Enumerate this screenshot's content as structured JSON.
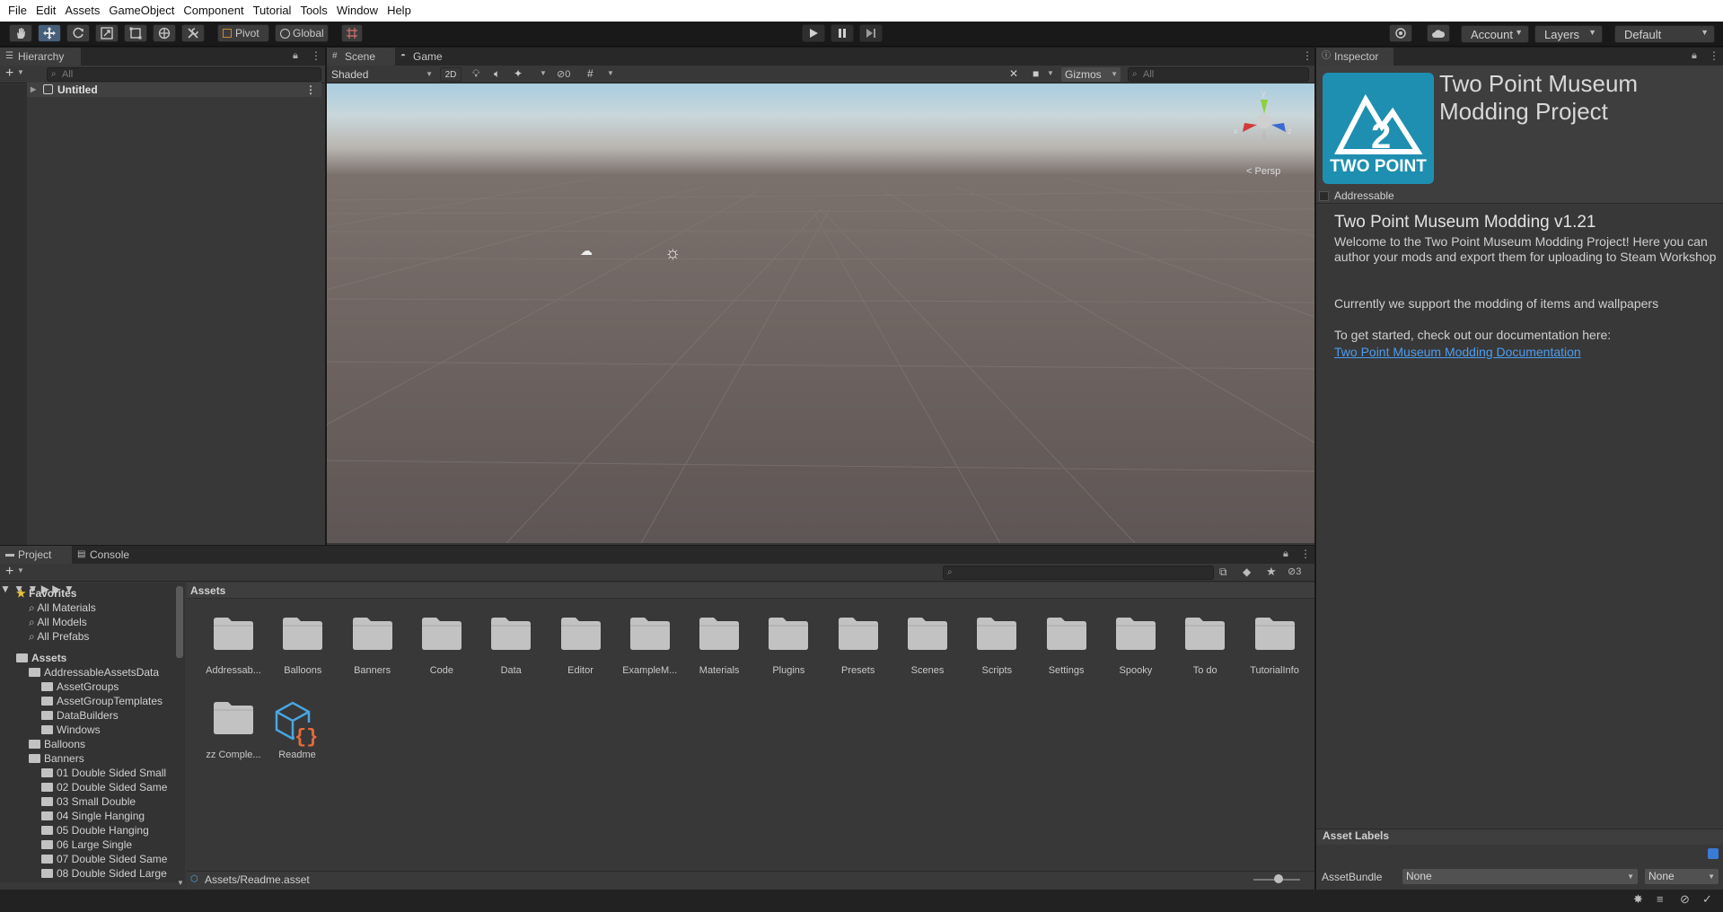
{
  "menu": [
    "File",
    "Edit",
    "Assets",
    "GameObject",
    "Component",
    "Tutorial",
    "Tools",
    "Window",
    "Help"
  ],
  "toolbar": {
    "pivot": "Pivot",
    "global": "Global",
    "account": "Account",
    "layers": "Layers",
    "layout": "Default"
  },
  "hierarchy": {
    "tab": "Hierarchy",
    "search_placeholder": "All",
    "scene_name": "Untitled"
  },
  "scene": {
    "tabs": [
      "Scene",
      "Game"
    ],
    "shading": "Shaded",
    "mode_2d": "2D",
    "hidden_count": "0",
    "gizmos": "Gizmos",
    "search_placeholder": "All",
    "projection": "Persp"
  },
  "inspector": {
    "tab": "Inspector",
    "logo_text": "TWO POINT",
    "title": "Two Point Museum Modding Project",
    "addressable": "Addressable",
    "heading": "Two Point Museum Modding v1.21",
    "paragraph1": "Welcome to the Two Point Museum Modding Project!  Here you can author your mods and export them for uploading to Steam Workshop",
    "paragraph2": "Currently we support the modding of items and wallpapers",
    "paragraph3": "To get started, check out our documentation here:",
    "link": "Two Point Museum Modding Documentation",
    "asset_labels": "Asset Labels",
    "assetbundle_label": "AssetBundle",
    "assetbundle_value": "None",
    "variant_value": "None",
    "colors": {
      "accent": "#1e8fb0",
      "link": "#4c9df0"
    }
  },
  "project": {
    "tabs": [
      "Project",
      "Console"
    ],
    "hidden_count": "3",
    "favorites": {
      "label": "Favorites",
      "items": [
        "All Materials",
        "All Models",
        "All Prefabs"
      ]
    },
    "tree": [
      {
        "label": "Assets",
        "depth": 0,
        "open": true,
        "bold": true
      },
      {
        "label": "AddressableAssetsData",
        "depth": 1,
        "open": true
      },
      {
        "label": "AssetGroups",
        "depth": 2,
        "closed": true
      },
      {
        "label": "AssetGroupTemplates",
        "depth": 2
      },
      {
        "label": "DataBuilders",
        "depth": 2
      },
      {
        "label": "Windows",
        "depth": 2
      },
      {
        "label": "Balloons",
        "depth": 1,
        "closed": true
      },
      {
        "label": "Banners",
        "depth": 1,
        "open": true
      },
      {
        "label": "01 Double Sided Small",
        "depth": 2
      },
      {
        "label": "02 Double Sided Same",
        "depth": 2
      },
      {
        "label": "03 Small Double",
        "depth": 2
      },
      {
        "label": "04 Single Hanging",
        "depth": 2
      },
      {
        "label": "05 Double Hanging",
        "depth": 2
      },
      {
        "label": "06 Large Single",
        "depth": 2
      },
      {
        "label": "07 Double Sided Same",
        "depth": 2
      },
      {
        "label": "08 Double Sided Large",
        "depth": 2
      }
    ],
    "breadcrumb": "Assets",
    "grid": [
      "Addressab...",
      "Balloons",
      "Banners",
      "Code",
      "Data",
      "Editor",
      "ExampleM...",
      "Materials",
      "Plugins",
      "Presets",
      "Scenes",
      "Scripts",
      "Settings",
      "Spooky",
      "To do",
      "TutorialInfo",
      "zz Comple..."
    ],
    "readme": "Readme",
    "footer_path": "Assets/Readme.asset"
  }
}
